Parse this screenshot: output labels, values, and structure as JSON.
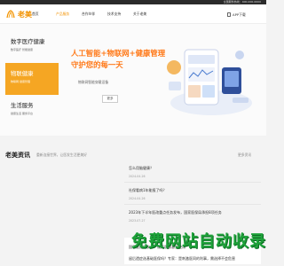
{
  "topbar": {
    "hotline": "全国服务热线：400-000-0000"
  },
  "nav": {
    "logo_text": "老美",
    "items": [
      {
        "label": "首页",
        "active": false
      },
      {
        "label": "产品服务",
        "active": true
      },
      {
        "label": "合作伙伴",
        "active": false
      },
      {
        "label": "技术支持",
        "active": false
      },
      {
        "label": "关于老美",
        "active": false
      }
    ],
    "right_label": "APP下载"
  },
  "hero": {
    "side_items": [
      {
        "title": "数字医疗健康",
        "subtitle": "数字医疗 智能健康",
        "active": false
      },
      {
        "title": "物联健康",
        "subtitle": "物联网 健康管理",
        "active": true
      },
      {
        "title": "生活服务",
        "subtitle": "健康生活 服务平台",
        "active": false
      }
    ],
    "title_line1": "人工智能+物联网+健康管理",
    "title_line2": "守护您的每一天",
    "subtitle": "物联网智能穿戴设备",
    "more_button": "更多"
  },
  "news": {
    "heading": "老美资讯",
    "tagline": "重新连接世界，让医发生活更美好",
    "more_link": "更多资讯",
    "items": [
      {
        "title": "怎么用脑健康？",
        "date": "2024-04-26"
      },
      {
        "title": "社保看病1年能报了吗？",
        "date": "2024-04-26"
      },
      {
        "title": "2023年下半年医改重点任务发布，国家医保局承担8项任务",
        "date": "2023-07-27"
      },
      {
        "title": "国家医保局发布：规范医保基金使用",
        "date": ""
      },
      {
        "title": "留后遗症选基础医保吗？专家：是刺激医同的利事，需选择不会危害",
        "date": ""
      }
    ]
  },
  "watermark": "免费网站自动收录",
  "colors": {
    "accent": "#f29200",
    "hero_title": "#ff7a1a",
    "active_side": "#f5a623",
    "watermark": "#1ea23a"
  }
}
